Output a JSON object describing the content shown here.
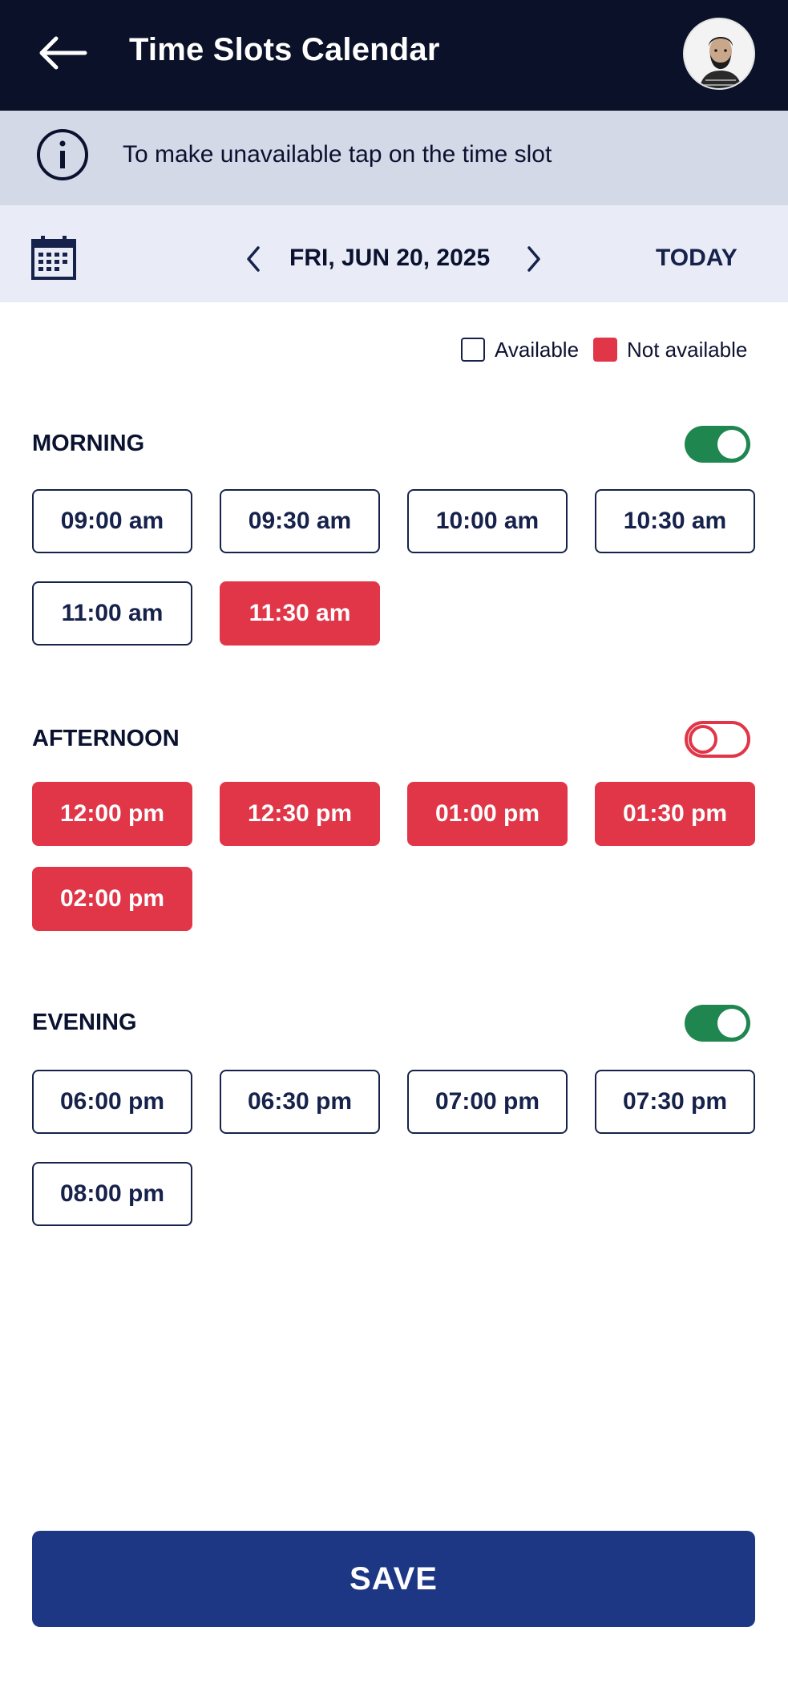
{
  "header": {
    "title": "Time Slots Calendar"
  },
  "info": {
    "text": "To make unavailable tap on the time slot"
  },
  "date_bar": {
    "date": "FRI, JUN 20, 2025",
    "today_label": "TODAY"
  },
  "legend": {
    "available_label": "Available",
    "not_available_label": "Not available"
  },
  "colors": {
    "header_bg": "#0a1128",
    "available_border": "#16224b",
    "unavailable": "#e03648",
    "toggle_on": "#1f8650",
    "save_button": "#1e3784"
  },
  "sections": [
    {
      "title": "MORNING",
      "toggle_on": true,
      "slots": [
        {
          "label": "09:00 am",
          "available": true
        },
        {
          "label": "09:30 am",
          "available": true
        },
        {
          "label": "10:00 am",
          "available": true
        },
        {
          "label": "10:30 am",
          "available": true
        },
        {
          "label": "11:00 am",
          "available": true
        },
        {
          "label": "11:30 am",
          "available": false
        }
      ]
    },
    {
      "title": "AFTERNOON",
      "toggle_on": false,
      "slots": [
        {
          "label": "12:00 pm",
          "available": false
        },
        {
          "label": "12:30 pm",
          "available": false
        },
        {
          "label": "01:00 pm",
          "available": false
        },
        {
          "label": "01:30 pm",
          "available": false
        },
        {
          "label": "02:00 pm",
          "available": false
        }
      ]
    },
    {
      "title": "EVENING",
      "toggle_on": true,
      "slots": [
        {
          "label": "06:00 pm",
          "available": true
        },
        {
          "label": "06:30 pm",
          "available": true
        },
        {
          "label": "07:00 pm",
          "available": true
        },
        {
          "label": "07:30 pm",
          "available": true
        },
        {
          "label": "08:00 pm",
          "available": true
        }
      ]
    }
  ],
  "save_label": "SAVE"
}
